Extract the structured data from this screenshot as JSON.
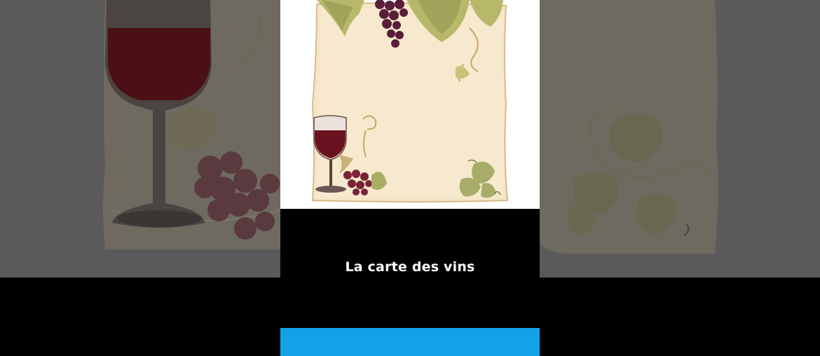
{
  "caption": {
    "text": "La carte des vins"
  },
  "colors": {
    "accent_bar": "#13a1e8",
    "background_black": "#000000",
    "dimmed_panel": "#5b5b5b",
    "paper": "#f3e3c4",
    "wine": "#6b1220",
    "grape": "#5a1e3a",
    "leaf": "#9aa36a"
  }
}
